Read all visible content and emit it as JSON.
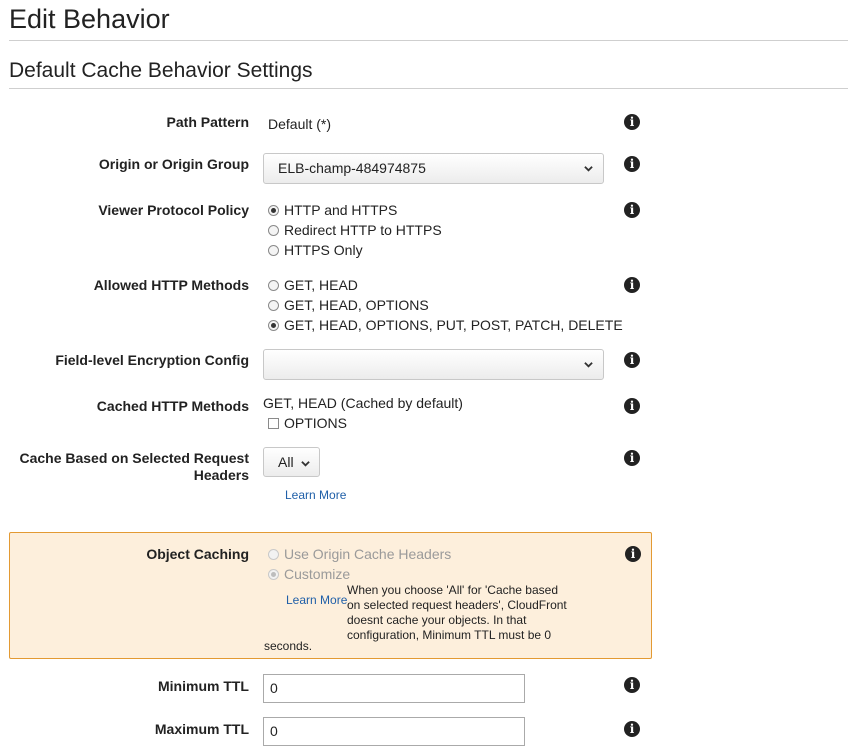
{
  "page_title": "Edit Behavior",
  "section_title": "Default Cache Behavior Settings",
  "fields": {
    "path_pattern": {
      "label": "Path Pattern",
      "value": "Default (*)"
    },
    "origin": {
      "label": "Origin or Origin Group",
      "selected": "ELB-champ-484974875"
    },
    "viewer_protocol": {
      "label": "Viewer Protocol Policy",
      "options": [
        "HTTP and HTTPS",
        "Redirect HTTP to HTTPS",
        "HTTPS Only"
      ],
      "selected_index": 0
    },
    "allowed_methods": {
      "label": "Allowed HTTP Methods",
      "options": [
        "GET, HEAD",
        "GET, HEAD, OPTIONS",
        "GET, HEAD, OPTIONS, PUT, POST, PATCH, DELETE"
      ],
      "selected_index": 2
    },
    "field_encryption": {
      "label": "Field-level Encryption Config",
      "selected": ""
    },
    "cached_methods": {
      "label": "Cached HTTP Methods",
      "value": "GET, HEAD (Cached by default)",
      "options_label": "OPTIONS",
      "options_checked": false
    },
    "cache_headers": {
      "label_line1": "Cache Based on Selected Request",
      "label_line2": "Headers",
      "selected": "All",
      "learn_more": "Learn More"
    },
    "object_caching": {
      "label": "Object Caching",
      "options": [
        "Use Origin Cache Headers",
        "Customize"
      ],
      "selected_index": 1,
      "disabled": true,
      "learn_more": "Learn More",
      "note_lines": [
        "When you choose 'All' for 'Cache based",
        "on selected request headers', CloudFront",
        "doesnt cache your objects. In that",
        "configuration, Minimum TTL must be 0"
      ],
      "note_tail": "seconds."
    },
    "min_ttl": {
      "label": "Minimum TTL",
      "value": "0"
    },
    "max_ttl": {
      "label": "Maximum TTL",
      "value": "0"
    }
  },
  "icons": {
    "info": "info-icon",
    "chevron": "chevron-down-icon"
  },
  "colors": {
    "link": "#1f5fa8",
    "warning_bg": "#fdefdc",
    "warning_border": "#e39a33"
  }
}
